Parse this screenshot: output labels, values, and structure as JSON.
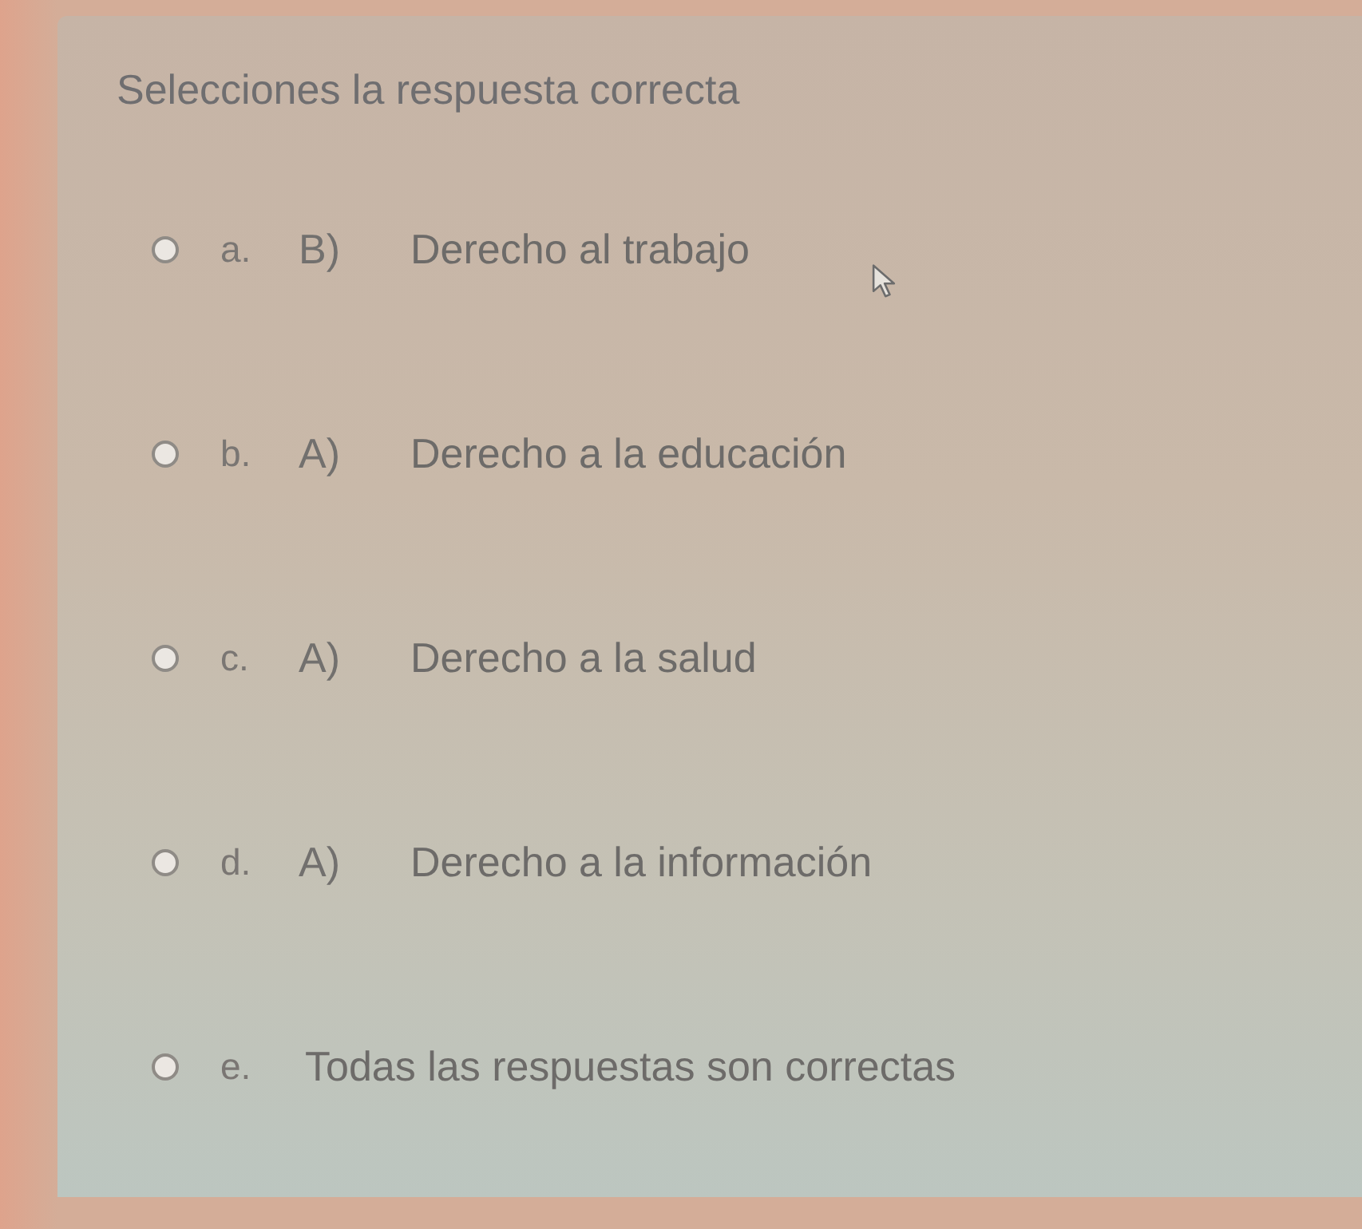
{
  "question": {
    "title": "Selecciones la respuesta correcta"
  },
  "options": [
    {
      "letter": "a.",
      "prefix": "B)",
      "text": "Derecho al trabajo",
      "selected": false
    },
    {
      "letter": "b.",
      "prefix": "A)",
      "text": "Derecho a la educación",
      "selected": false
    },
    {
      "letter": "c.",
      "prefix": "A)",
      "text": "Derecho a la salud",
      "selected": false
    },
    {
      "letter": "d.",
      "prefix": "A)",
      "text": "Derecho a la información",
      "selected": false
    },
    {
      "letter": "e.",
      "text": "Todas las respuestas son correctas",
      "selected": false
    }
  ]
}
